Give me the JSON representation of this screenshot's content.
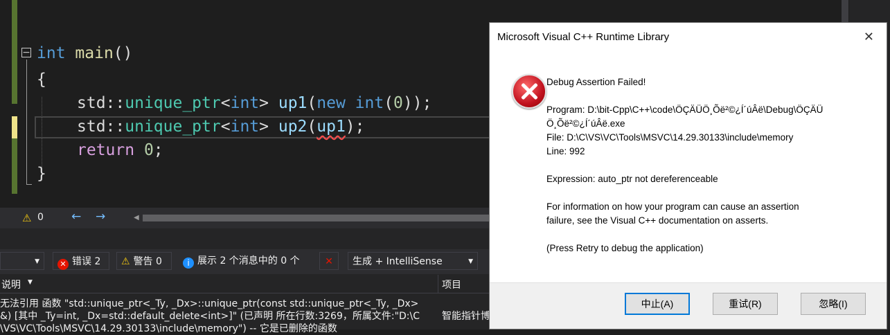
{
  "editor": {
    "lines": {
      "l1_kw": "int",
      "l1_fn": "main",
      "l1_rest": "()",
      "l2": "{",
      "l3_ns": "std::",
      "l3_ty": "unique_ptr",
      "l3_lt": "<",
      "l3_kw": "int",
      "l3_gt": "> ",
      "l3_var": "up1",
      "l3_p": "(",
      "l3_new": "new",
      "l3_kw2": " int",
      "l3_p2": "(",
      "l3_num": "0",
      "l3_end": "));",
      "l4_ns": "std::",
      "l4_ty": "unique_ptr",
      "l4_lt": "<",
      "l4_kw": "int",
      "l4_gt": "> ",
      "l4_var": "up2",
      "l4_p": "(",
      "l4_arg": "up1",
      "l4_end": ");",
      "l5_ret": "return",
      "l5_num": " 0",
      "l5_end": ";",
      "l6": "}"
    }
  },
  "navbar": {
    "warn_count": "0",
    "back": "←",
    "forward": "→",
    "scroll_left": "◀"
  },
  "errorlist": {
    "scope_select": "",
    "errors_label": "错误 2",
    "warnings_label": "警告 0",
    "messages_label": "展示 2 个消息中的 0 个",
    "build_select": "生成 + IntelliSense",
    "col_desc": "说明",
    "col_project": "项目",
    "row1": "无法引用 函数 \"std::unique_ptr<_Ty, _Dx>::unique_ptr(const std::unique_ptr<_Ty, _Dx>",
    "row2": "&) [其中 _Ty=int, _Dx=std::default_delete<int>]\" (已声明 所在行数:3269，所属文件:\"D:\\C",
    "row3": "\\VS\\VC\\Tools\\MSVC\\14.29.30133\\include\\memory\") -- 它是已删除的函数",
    "row1_project": "智能指针博"
  },
  "dialog": {
    "title": "Microsoft Visual C++ Runtime Library",
    "close": "✕",
    "heading": "Debug Assertion Failed!",
    "program1": "Program: D:\\bit-Cpp\\C++\\code\\ÖÇÄÜÖ¸Õë²©¿Í´úÂë\\Debug\\ÖÇÄÜ",
    "program2": "Ö¸Õë²©¿Í´úÂë.exe",
    "file": "File: D:\\C\\VS\\VC\\Tools\\MSVC\\14.29.30133\\include\\memory",
    "line": "Line: 992",
    "expression": "Expression: auto_ptr not dereferenceable",
    "info1": "For information on how your program can cause an assertion",
    "info2": "failure, see the Visual C++ documentation on asserts.",
    "retry_hint": "(Press Retry to debug the application)",
    "btn_abort": "中止(A)",
    "btn_retry": "重试(R)",
    "btn_ignore": "忽略(I)"
  }
}
